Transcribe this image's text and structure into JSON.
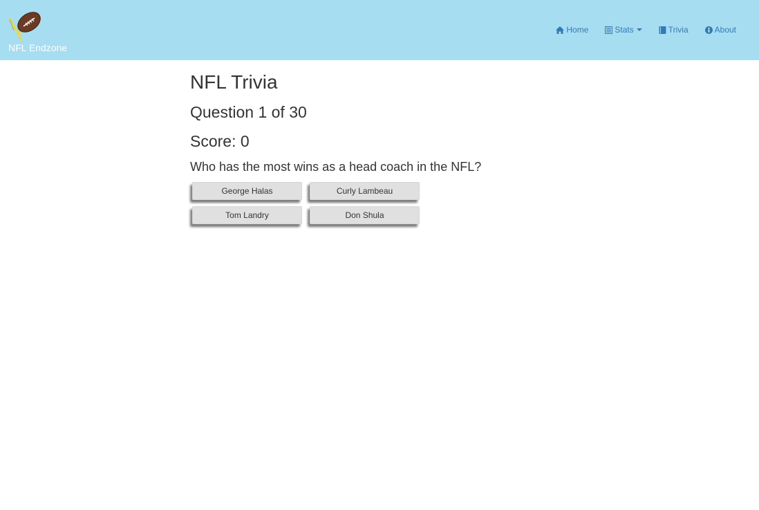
{
  "navbar": {
    "brand": "NFL Endzone",
    "items": [
      {
        "label": "Home",
        "icon": "home-icon"
      },
      {
        "label": "Stats",
        "icon": "list-icon",
        "dropdown": true
      },
      {
        "label": "Trivia",
        "icon": "book-icon"
      },
      {
        "label": "About",
        "icon": "info-icon"
      }
    ]
  },
  "trivia": {
    "title": "NFL Trivia",
    "question_counter": "Question 1 of 30",
    "score": "Score: 0",
    "question": "Who has the most wins as a head coach in the NFL?",
    "answers": [
      "George Halas",
      "Curly Lambeau",
      "Tom Landry",
      "Don Shula"
    ]
  },
  "colors": {
    "navbar_bg": "#a6ddf0",
    "link": "#337ab7",
    "button_bg": "#e0e0e0"
  }
}
